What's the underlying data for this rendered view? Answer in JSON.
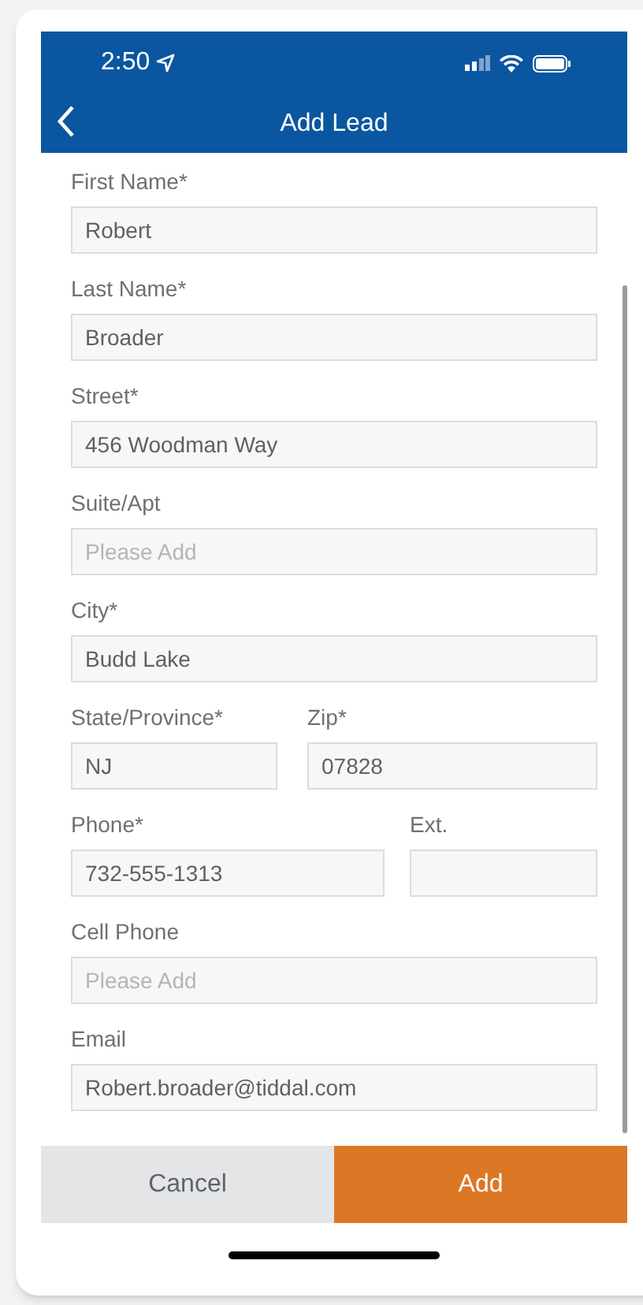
{
  "status_bar": {
    "time": "2:50"
  },
  "nav": {
    "title": "Add Lead"
  },
  "form_rows": [
    {
      "kind": "single",
      "fields": [
        {
          "label": "First Name*",
          "value": "Robert"
        }
      ]
    },
    {
      "kind": "single",
      "fields": [
        {
          "label": "Last Name*",
          "value": "Broader"
        }
      ]
    },
    {
      "kind": "single",
      "fields": [
        {
          "label": "Street*",
          "value": "456 Woodman Way"
        }
      ]
    },
    {
      "kind": "single",
      "fields": [
        {
          "label": "Suite/Apt",
          "placeholder": "Please Add"
        }
      ]
    },
    {
      "kind": "single",
      "fields": [
        {
          "label": "City*",
          "value": "Budd Lake"
        }
      ]
    },
    {
      "kind": "narrow_wide",
      "fields": [
        {
          "label": "State/Province*",
          "value": "NJ"
        },
        {
          "label": "Zip*",
          "value": "07828"
        }
      ]
    },
    {
      "kind": "wide_narrow",
      "fields": [
        {
          "label": "Phone*",
          "value": "732-555-1313"
        },
        {
          "label": "Ext."
        }
      ]
    },
    {
      "kind": "single",
      "fields": [
        {
          "label": "Cell Phone",
          "placeholder": "Please Add"
        }
      ]
    },
    {
      "kind": "single",
      "fields": [
        {
          "label": "Email",
          "value": "Robert.broader@tiddal.com"
        }
      ]
    }
  ],
  "buttons": [
    {
      "kind": "secondary",
      "label": "Cancel"
    },
    {
      "kind": "primary",
      "label": "Add"
    }
  ]
}
